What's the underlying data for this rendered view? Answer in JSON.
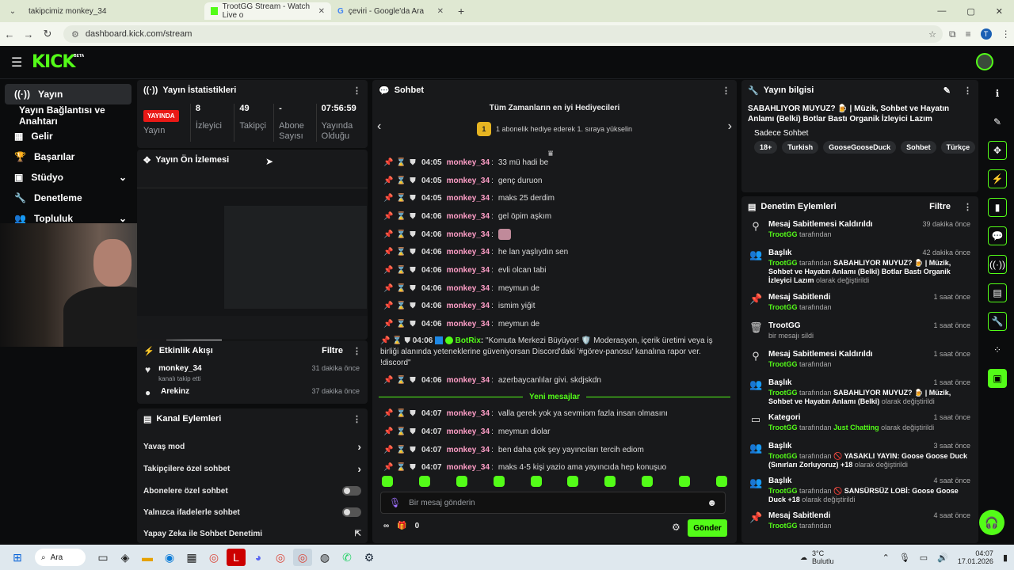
{
  "browser": {
    "tabs": [
      {
        "label": "takipcimiz monkey_34",
        "active": false
      },
      {
        "label": "TrootGG Stream - Watch Live o",
        "active": true
      },
      {
        "label": "çeviri - Google'da Ara",
        "active": false
      }
    ],
    "url": "dashboard.kick.com/stream",
    "profile": "T"
  },
  "app": {
    "logo": "KICK",
    "logo_badge": "BETA"
  },
  "sidebar": {
    "items": [
      {
        "label": "Yayın",
        "icon": "broadcast-icon"
      },
      {
        "label": "Yayın Bağlantısı ve Anahtarı",
        "icon": ""
      },
      {
        "label": "Gelir",
        "icon": "grid-icon"
      },
      {
        "label": "Başarılar",
        "icon": "trophy-icon"
      },
      {
        "label": "Stüdyo",
        "icon": "studio-icon"
      },
      {
        "label": "Denetleme",
        "icon": "wrench-icon"
      },
      {
        "label": "Topluluk",
        "icon": "people-icon"
      }
    ]
  },
  "stats": {
    "title": "Yayın İstatistikleri",
    "live_badge": "YAYINDA",
    "live_label": "Yayın",
    "viewers": "8",
    "viewers_label": "İzleyici",
    "followers": "49",
    "followers_label": "Takipçi",
    "subs": "-",
    "subs_label": "Abone Sayısı",
    "uptime": "07:56:59",
    "uptime_label": "Yayında Olduğu"
  },
  "preview": {
    "title": "Yayın Ön İzlemesi"
  },
  "activity": {
    "title": "Etkinlik Akışı",
    "filter": "Filtre",
    "items": [
      {
        "user": "monkey_34",
        "action": "kanalı takip etti",
        "time": "31 dakika önce"
      },
      {
        "user": "Arekinz",
        "action": "",
        "time": "37 dakika önce"
      }
    ]
  },
  "channel_actions": {
    "title": "Kanal Eylemleri",
    "items": [
      {
        "label": "Yavaş mod"
      },
      {
        "label": "Takipçilere özel sohbet"
      },
      {
        "label": "Abonelere özel sohbet"
      },
      {
        "label": "Yalnızca ifadelerle sohbet"
      },
      {
        "label": "Yapay Zeka ile Sohbet Denetimi"
      }
    ]
  },
  "chat": {
    "title": "Sohbet",
    "gifters_title": "Tüm Zamanların en iyi Hediyecileri",
    "gifters_rank": "1",
    "gifters_sub": "1 abonelik hediye ederek 1. sıraya yükselin",
    "messages": [
      {
        "time": "04:05",
        "user": "monkey_34",
        "text": "33 mü hadi be"
      },
      {
        "time": "04:05",
        "user": "monkey_34",
        "text": "genç duruon"
      },
      {
        "time": "04:05",
        "user": "monkey_34",
        "text": "maks 25 derdim"
      },
      {
        "time": "04:06",
        "user": "monkey_34",
        "text": "gel öpim aşkım"
      },
      {
        "time": "04:06",
        "user": "monkey_34",
        "text": ""
      },
      {
        "time": "04:06",
        "user": "monkey_34",
        "text": "he lan yaşlıydın sen"
      },
      {
        "time": "04:06",
        "user": "monkey_34",
        "text": "evli olcan tabi"
      },
      {
        "time": "04:06",
        "user": "monkey_34",
        "text": "meymun de"
      },
      {
        "time": "04:06",
        "user": "monkey_34",
        "text": "ismim yiğit"
      },
      {
        "time": "04:06",
        "user": "monkey_34",
        "text": "meymun de"
      }
    ],
    "bot": {
      "time": "04:06",
      "user": "BotRix",
      "text": "\"Komuta Merkezi Büyüyor! 🛡️ Moderasyon, içerik üretimi veya iş birliği alanında yeteneklerine güveniyorsan Discord'daki '#görev-panosu' kanalına rapor ver. !discord\""
    },
    "after_bot": {
      "time": "04:06",
      "user": "monkey_34",
      "text": "azerbaycanlılar givi. skdjskdn"
    },
    "new_messages": "Yeni mesajlar",
    "new": [
      {
        "time": "04:07",
        "user": "monkey_34",
        "text": "valla gerek yok ya sevmiom fazla insan olmasını"
      },
      {
        "time": "04:07",
        "user": "monkey_34",
        "text": "meymun diolar"
      },
      {
        "time": "04:07",
        "user": "monkey_34",
        "text": "ben daha çok şey yayıncıları tercih ediom"
      },
      {
        "time": "04:07",
        "user": "monkey_34",
        "text": "maks 4-5 kişi yazio ama yayıncıda hep konuşuo"
      }
    ],
    "input_placeholder": "Bir mesaj gönderin",
    "points": "0",
    "send": "Gönder"
  },
  "stream_info": {
    "title": "Yayın bilgisi",
    "stream_title": "SABAHLIYOR MUYUZ? 🍺 | Müzik, Sohbet ve Hayatın Anlamı (Belki) Botlar Bastı Organik İzleyici Lazım",
    "category": "Sadece Sohbet",
    "tags": [
      "18+",
      "Turkish",
      "GooseGooseDuck",
      "Sohbet",
      "Türkçe"
    ]
  },
  "mod_actions": {
    "title": "Denetim Eylemleri",
    "filter": "Filtre",
    "items": [
      {
        "icon": "unpin-icon",
        "title": "Mesaj Sabitlemesi Kaldırıldı",
        "time": "39 dakika önce",
        "actor": "TrootGG",
        "detail": "tarafından",
        "value": "",
        "suffix": ""
      },
      {
        "icon": "people-icon",
        "title": "Başlık",
        "time": "42 dakika önce",
        "actor": "TrootGG",
        "detail": "tarafından",
        "value": "SABAHLIYOR MUYUZ? 🍺 | Müzik, Sohbet ve Hayatın Anlamı (Belki) Botlar Bastı Organik İzleyici Lazım",
        "suffix": "olarak değiştirildi"
      },
      {
        "icon": "pin-icon",
        "title": "Mesaj Sabitlendi",
        "time": "1 saat önce",
        "actor": "TrootGG",
        "detail": "tarafından",
        "value": "",
        "suffix": ""
      },
      {
        "icon": "trash-icon",
        "title": "TrootGG",
        "time": "1 saat önce",
        "actor": "",
        "detail": "bir mesajı sildi",
        "value": "",
        "suffix": ""
      },
      {
        "icon": "unpin-icon",
        "title": "Mesaj Sabitlemesi Kaldırıldı",
        "time": "1 saat önce",
        "actor": "TrootGG",
        "detail": "tarafından",
        "value": "",
        "suffix": ""
      },
      {
        "icon": "people-icon",
        "title": "Başlık",
        "time": "1 saat önce",
        "actor": "TrootGG",
        "detail": "tarafından",
        "value": "SABAHLIYOR MUYUZ? 🍺 | Müzik, Sohbet ve Hayatın Anlamı (Belki)",
        "suffix": "olarak değiştirildi"
      },
      {
        "icon": "category-icon",
        "title": "Kategori",
        "time": "1 saat önce",
        "actor": "TrootGG",
        "detail": "tarafından",
        "value": "Just Chatting",
        "suffix": "olarak değiştirildi"
      },
      {
        "icon": "people-icon",
        "title": "Başlık",
        "time": "3 saat önce",
        "actor": "TrootGG",
        "detail": "tarafından",
        "value": "🚫 YASAKLI YAYIN: Goose Goose Duck (Sınırları Zorluyoruz) +18",
        "suffix": "olarak değiştirildi"
      },
      {
        "icon": "people-icon",
        "title": "Başlık",
        "time": "4 saat önce",
        "actor": "TrootGG",
        "detail": "tarafından",
        "value": "🚫 SANSÜRSÜZ LOBİ: Goose Goose Duck +18",
        "suffix": "olarak değiştirildi"
      },
      {
        "icon": "pin-icon",
        "title": "Mesaj Sabitlendi",
        "time": "4 saat önce",
        "actor": "TrootGG",
        "detail": "tarafından",
        "value": "",
        "suffix": ""
      }
    ]
  },
  "taskbar": {
    "search": "Ara",
    "weather_temp": "3°C",
    "weather_desc": "Bulutlu",
    "time": "04:07",
    "date": "17.01.2026"
  },
  "colors": {
    "accent": "#53fc18",
    "username": "#ff9ec7",
    "live": "#e91916"
  }
}
